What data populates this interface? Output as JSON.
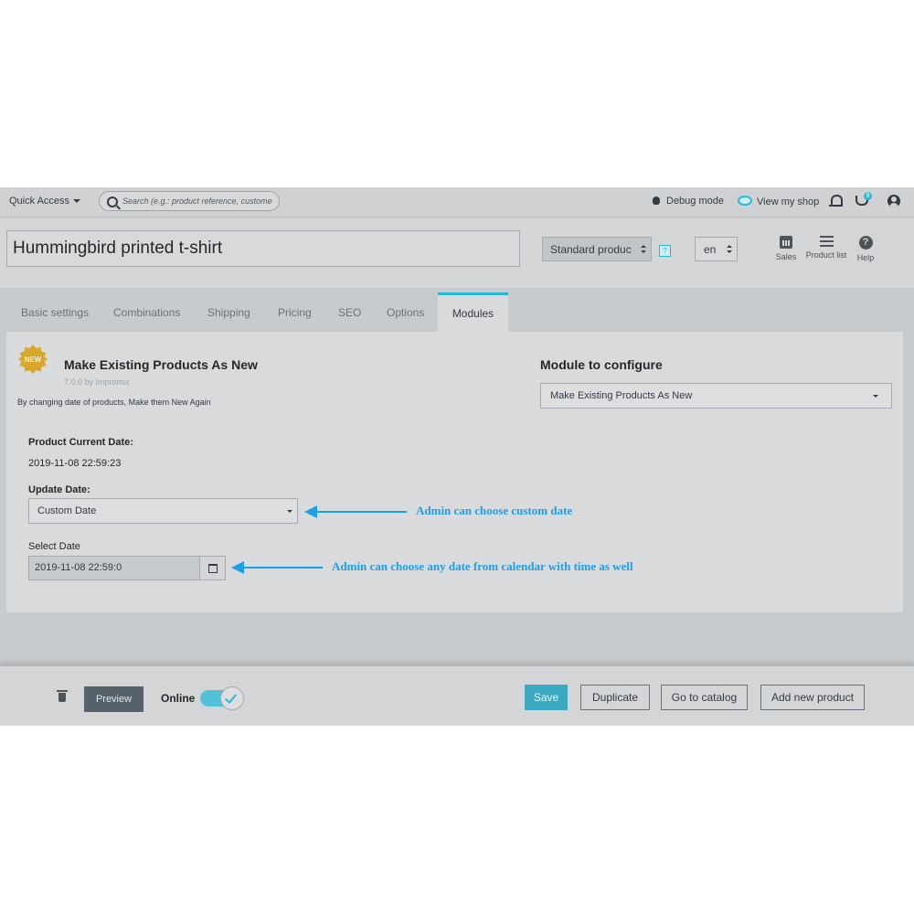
{
  "topbar": {
    "quick_access": "Quick Access",
    "search_placeholder": "Search (e.g.: product reference, custome",
    "debug_mode": "Debug mode",
    "view_shop": "View my shop",
    "notification_badge": "9"
  },
  "header": {
    "product_name": "Hummingbird printed t-shirt",
    "product_type": "Standard produc",
    "help_mark": "?",
    "language": "en",
    "icons": [
      {
        "label": "Sales",
        "icon": "bar-chart-icon"
      },
      {
        "label": "Product list",
        "icon": "list-icon"
      },
      {
        "label": "Help",
        "icon": "help-icon"
      }
    ]
  },
  "tabs": [
    "Basic settings",
    "Combinations",
    "Shipping",
    "Pricing",
    "SEO",
    "Options",
    "Modules"
  ],
  "active_tab": "Modules",
  "module": {
    "badge": "NEW",
    "title": "Make Existing Products As New",
    "version": "7.0.0 by Impromix",
    "description": "By changing date of products, Make them New Again",
    "configure_title": "Module to configure",
    "configure_value": "Make Existing Products As New"
  },
  "form": {
    "current_date_label": "Product Current Date:",
    "current_date_value": "2019-11-08 22:59:23",
    "update_date_label": "Update Date:",
    "update_date_value": "Custom Date",
    "select_date_label": "Select Date",
    "select_date_value": "2019-11-08 22:59:0"
  },
  "annotations": {
    "custom_date": "Admin can choose custom date",
    "calendar": "Admin can choose any date from calendar with time as well"
  },
  "footer": {
    "preview": "Preview",
    "online": "Online",
    "online_enabled": true,
    "save": "Save",
    "duplicate": "Duplicate",
    "go_to_catalog": "Go to catalog",
    "add_new_product": "Add new product"
  },
  "colors": {
    "accent": "#25b9d7",
    "annotation": "#1d9ee8",
    "overlay_bg": "#c8cbcd"
  }
}
